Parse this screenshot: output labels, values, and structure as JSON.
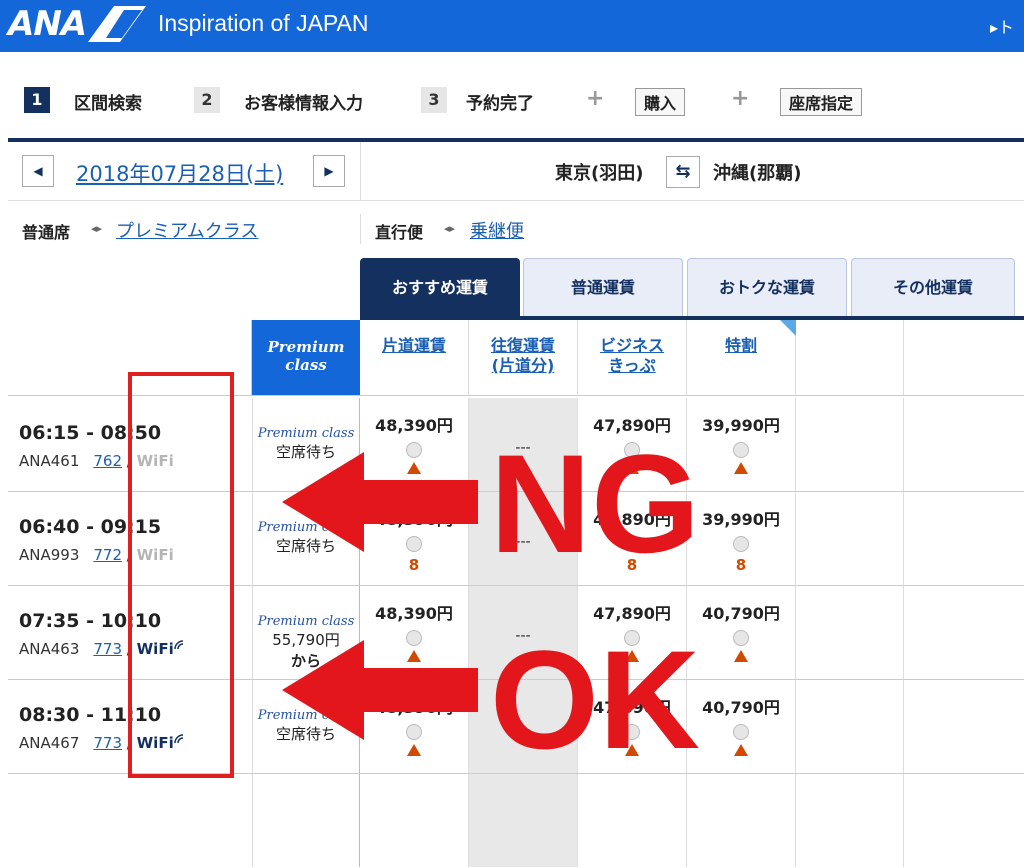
{
  "header": {
    "logo_text": "ANA",
    "tagline": "Inspiration of JAPAN",
    "right_text": "▸ト"
  },
  "steps": [
    {
      "num": "1",
      "label": "区間検索",
      "active": true
    },
    {
      "num": "2",
      "label": "お客様情報入力",
      "active": false
    },
    {
      "num": "3",
      "label": "予約完了",
      "active": false
    }
  ],
  "step_extras": {
    "plus": "+",
    "purchase": "購入",
    "seat": "座席指定"
  },
  "date_nav": {
    "prev_icon": "chevron-left-icon",
    "next_icon": "chevron-right-icon",
    "date": "2018年07月28日(土)",
    "prev_glyph": "◀",
    "next_glyph": "▶"
  },
  "route": {
    "from": "東京(羽田)",
    "to": "沖縄(那覇)",
    "swap_glyph": "⇆"
  },
  "class_toggle": {
    "current": "普通席",
    "icon": "◂▸",
    "other": "プレミアムクラス"
  },
  "flight_toggle": {
    "current": "直行便",
    "icon": "◂▸",
    "other": "乗継便"
  },
  "fare_tabs": [
    {
      "label": "おすすめ運賃",
      "active": true
    },
    {
      "label": "普通運賃",
      "active": false
    },
    {
      "label": "おトクな運賃",
      "active": false
    },
    {
      "label": "その他運賃",
      "active": false
    }
  ],
  "table_header": {
    "premium": {
      "line1": "Premium",
      "line2": "class"
    },
    "columns": [
      {
        "line1": "片道運賃",
        "line2": ""
      },
      {
        "line1": "往復運賃",
        "line2": "(片道分)"
      },
      {
        "line1": "ビジネス",
        "line2": "きっぷ"
      },
      {
        "line1": "特割",
        "line2": ""
      }
    ]
  },
  "premium_logo": "Premium class",
  "flights": [
    {
      "time": "06:15 - 08:50",
      "flight_no": "ANA461",
      "aircraft": "762",
      "sep": "/",
      "wifi": "WiFi",
      "wifi_on": false,
      "premium": {
        "line1": "空席待ち",
        "line2": ""
      },
      "fares": [
        {
          "price": "48,390円",
          "mark": "tri",
          "seats": ""
        },
        {
          "price": "---",
          "mark": "",
          "seats": ""
        },
        {
          "price": "47,890円",
          "mark": "tri",
          "seats": ""
        },
        {
          "price": "39,990円",
          "mark": "tri",
          "seats": ""
        }
      ]
    },
    {
      "time": "06:40 - 09:15",
      "flight_no": "ANA993",
      "aircraft": "772",
      "sep": "/",
      "wifi": "WiFi",
      "wifi_on": false,
      "premium": {
        "line1": "空席待ち",
        "line2": ""
      },
      "fares": [
        {
          "price": "48,390円",
          "mark": "seats",
          "seats": "8"
        },
        {
          "price": "---",
          "mark": "",
          "seats": ""
        },
        {
          "price": "47,890円",
          "mark": "seats",
          "seats": "8"
        },
        {
          "price": "39,990円",
          "mark": "seats",
          "seats": "8"
        }
      ]
    },
    {
      "time": "07:35 - 10:10",
      "flight_no": "ANA463",
      "aircraft": "773",
      "sep": "/",
      "wifi": "WiFi",
      "wifi_on": true,
      "premium": {
        "line1": "55,790円",
        "line2": "から"
      },
      "fares": [
        {
          "price": "48,390円",
          "mark": "tri",
          "seats": ""
        },
        {
          "price": "---",
          "mark": "",
          "seats": ""
        },
        {
          "price": "47,890円",
          "mark": "tri",
          "seats": ""
        },
        {
          "price": "40,790円",
          "mark": "tri",
          "seats": ""
        }
      ]
    },
    {
      "time": "08:30 - 11:10",
      "flight_no": "ANA467",
      "aircraft": "773",
      "sep": "/",
      "wifi": "WiFi",
      "wifi_on": true,
      "premium": {
        "line1": "空席待ち",
        "line2": ""
      },
      "fares": [
        {
          "price": "48,390円",
          "mark": "tri",
          "seats": ""
        },
        {
          "price": "---",
          "mark": "",
          "seats": ""
        },
        {
          "price": "47,890円",
          "mark": "tri",
          "seats": ""
        },
        {
          "price": "40,790円",
          "mark": "tri",
          "seats": ""
        }
      ]
    }
  ],
  "overlays": {
    "ng": "NG",
    "ok": "OK",
    "color": "#e3161b"
  }
}
